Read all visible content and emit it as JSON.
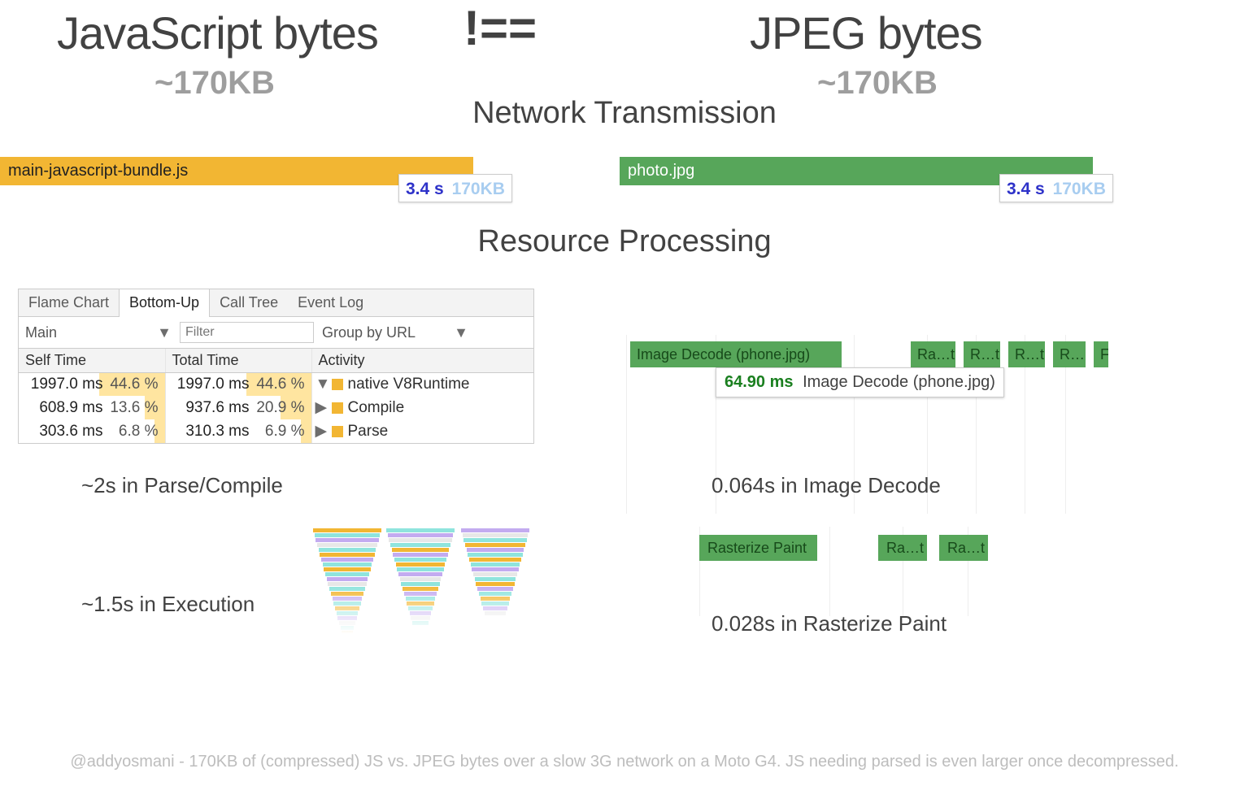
{
  "headline": {
    "js_title": "JavaScript bytes",
    "neq": "!==",
    "jpeg_title": "JPEG bytes"
  },
  "sizes": {
    "js": "~170KB",
    "jpeg": "~170KB"
  },
  "sections": {
    "network": "Network Transmission",
    "processing": "Resource Processing"
  },
  "network": {
    "js_file": "main-javascript-bundle.js",
    "jpg_file": "photo.jpg",
    "js_badge": {
      "time": "3.4 s",
      "size": "170KB"
    },
    "jpg_badge": {
      "time": "3.4 s",
      "size": "170KB"
    }
  },
  "devtools": {
    "tabs": [
      "Flame Chart",
      "Bottom-Up",
      "Call Tree",
      "Event Log"
    ],
    "active_tab_index": 1,
    "thread_select": "Main",
    "filter_placeholder": "Filter",
    "group_select": "Group by URL",
    "columns": [
      "Self Time",
      "Total Time",
      "Activity"
    ],
    "rows": [
      {
        "self_ms": "1997.0 ms",
        "self_pct": "44.6 %",
        "self_bar": 44.6,
        "total_ms": "1997.0 ms",
        "total_pct": "44.6 %",
        "total_bar": 44.6,
        "arrow": "▼",
        "activity": "native V8Runtime"
      },
      {
        "self_ms": "608.9 ms",
        "self_pct": "13.6 %",
        "self_bar": 13.6,
        "total_ms": "937.6 ms",
        "total_pct": "20.9 %",
        "total_bar": 20.9,
        "arrow": "▶",
        "activity": "Compile"
      },
      {
        "self_ms": "303.6 ms",
        "self_pct": "6.8 %",
        "self_bar": 6.8,
        "total_ms": "310.3 ms",
        "total_pct": "6.9 %",
        "total_bar": 6.9,
        "arrow": "▶",
        "activity": "Parse"
      }
    ]
  },
  "decode": {
    "main_chip": "Image Decode (phone.jpg)",
    "small_chips": [
      "Ra…t",
      "R…t",
      "R…t",
      "R…",
      "F"
    ],
    "tooltip_ms": "64.90 ms",
    "tooltip_label": "Image Decode (phone.jpg)"
  },
  "rasterize": {
    "chips": [
      "Rasterize Paint",
      "Ra…t",
      "Ra…t"
    ]
  },
  "summaries": {
    "js_parse": "~2s in Parse/Compile",
    "js_exec": "~1.5s in Execution",
    "jpg_decode": "0.064s in Image Decode",
    "jpg_raster": "0.028s in Rasterize Paint"
  },
  "footer": "@addyosmani - 170KB of (compressed) JS vs. JPEG bytes over a slow 3G network on a Moto G4. JS needing parsed is even larger once decompressed."
}
